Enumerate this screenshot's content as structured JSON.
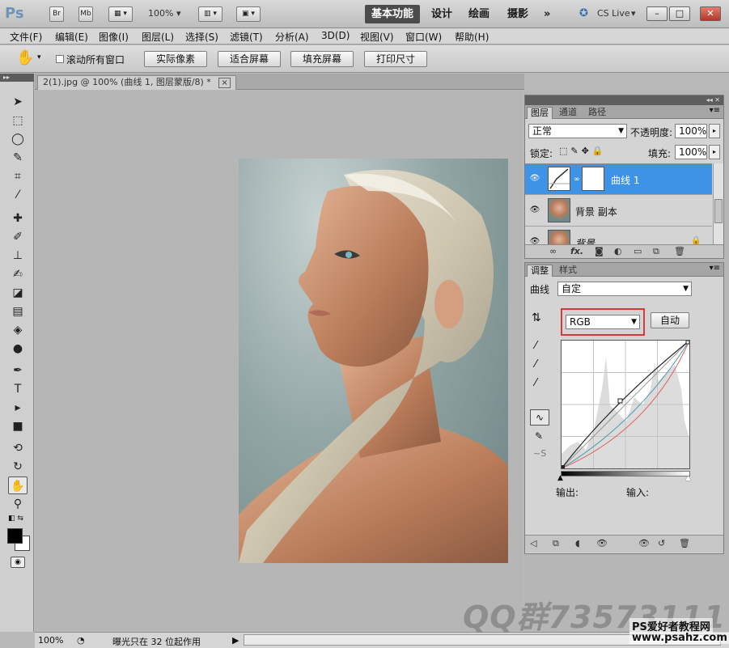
{
  "app": {
    "logo": "Ps",
    "bridge_btn": "Br",
    "minibridge_btn": "Mb",
    "zoom": "100%",
    "workspaces": [
      "基本功能",
      "设计",
      "绘画",
      "摄影"
    ],
    "more": "»",
    "cslive": "CS Live"
  },
  "menu": [
    "文件(F)",
    "编辑(E)",
    "图像(I)",
    "图层(L)",
    "选择(S)",
    "滤镜(T)",
    "分析(A)",
    "3D(D)",
    "视图(V)",
    "窗口(W)",
    "帮助(H)"
  ],
  "options": {
    "scroll_all_label": "滚动所有窗口",
    "buttons": [
      "实际像素",
      "适合屏幕",
      "填充屏幕",
      "打印尺寸"
    ]
  },
  "document": {
    "tab_title": "2(1).jpg @ 100% (曲线 1, 图层蒙版/8) *",
    "close": "×"
  },
  "status": {
    "zoom": "100%",
    "message": "曝光只在 32 位起作用"
  },
  "layers_panel": {
    "tabs": [
      "图层",
      "通道",
      "路径"
    ],
    "blend_mode": "正常",
    "opacity_label": "不透明度:",
    "opacity_value": "100%",
    "lock_label": "锁定:",
    "fill_label": "填充:",
    "fill_value": "100%",
    "layers": [
      {
        "name": "曲线 1",
        "selected": true
      },
      {
        "name": "背景 副本",
        "selected": false
      },
      {
        "name": "背景",
        "selected": false
      }
    ]
  },
  "adjust_panel": {
    "tabs": [
      "调整",
      "样式"
    ],
    "type_label": "曲线",
    "preset": "自定",
    "channel": "RGB",
    "auto_btn": "自动",
    "output_label": "输出:",
    "input_label": "输入:"
  },
  "watermark": {
    "qq": "QQ群73573111",
    "site_name": "PS爱好者教程网",
    "site_url": "www.psahz.com"
  },
  "colors": {
    "accent": "#3f93e6",
    "highlight_border": "#d33b3b"
  }
}
